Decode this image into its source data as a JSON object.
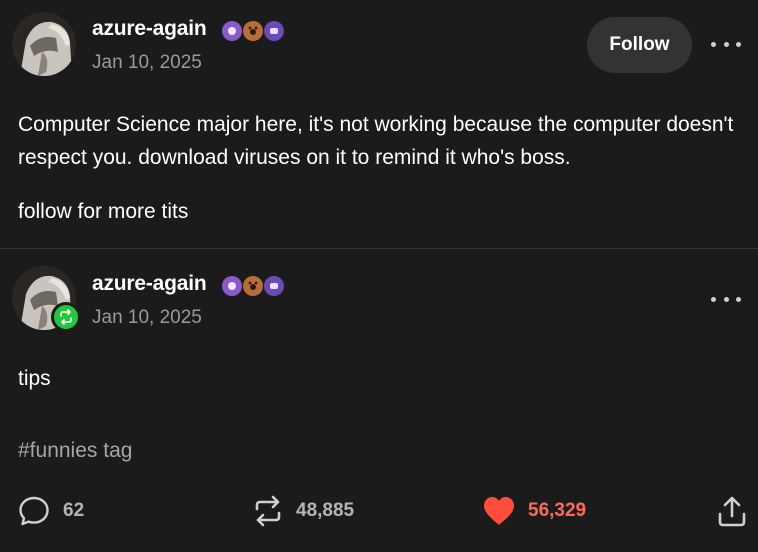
{
  "posts": [
    {
      "username": "azure-again",
      "date": "Jan 10, 2025",
      "follow_label": "Follow",
      "paragraphs": [
        "Computer Science major here, it's not working because the computer doesn't respect you. download viruses on it to remind it who's boss.",
        "follow for more tits"
      ]
    },
    {
      "username": "azure-again",
      "date": "Jan 10, 2025",
      "paragraphs": [
        "tips"
      ],
      "tag": "#funnies tag"
    }
  ],
  "actions": {
    "replies": "62",
    "reblogs": "48,885",
    "likes": "56,329"
  },
  "colors": {
    "background": "#1b1b1c",
    "like": "#ff6a57",
    "reblog_badge": "#23c63c"
  },
  "icons": [
    "ellipsis-icon",
    "reply-icon",
    "reblog-icon",
    "heart-icon",
    "share-icon",
    "badge-icon"
  ]
}
